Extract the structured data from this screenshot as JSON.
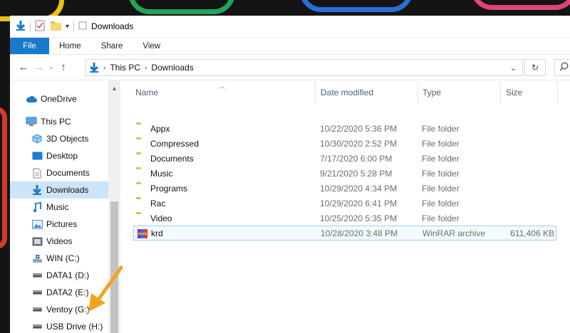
{
  "window": {
    "title": "Downloads",
    "colors": {
      "accent": "#1979ca",
      "selection": "#cce4f7",
      "folder": "#f8d775"
    }
  },
  "ribbon": {
    "tabs": [
      {
        "label": "File"
      },
      {
        "label": "Home"
      },
      {
        "label": "Share"
      },
      {
        "label": "View"
      }
    ]
  },
  "address": {
    "crumbs": [
      "This PC",
      "Downloads"
    ]
  },
  "sidebar": {
    "items": [
      {
        "label": "OneDrive",
        "icon": "cloud-icon"
      },
      {
        "label": "This PC",
        "icon": "computer-icon"
      },
      {
        "label": "3D Objects",
        "icon": "cube-icon"
      },
      {
        "label": "Desktop",
        "icon": "desktop-icon"
      },
      {
        "label": "Documents",
        "icon": "document-icon"
      },
      {
        "label": "Downloads",
        "icon": "download-icon",
        "selected": true
      },
      {
        "label": "Music",
        "icon": "music-icon"
      },
      {
        "label": "Pictures",
        "icon": "picture-icon"
      },
      {
        "label": "Videos",
        "icon": "video-icon"
      },
      {
        "label": "WIN (C:)",
        "icon": "windows-drive-icon"
      },
      {
        "label": "DATA1 (D:)",
        "icon": "drive-icon"
      },
      {
        "label": "DATA2 (E:)",
        "icon": "drive-icon"
      },
      {
        "label": "Ventoy (G:)",
        "icon": "drive-icon"
      },
      {
        "label": "USB Drive (H:)",
        "icon": "drive-icon"
      }
    ]
  },
  "columns": {
    "name": "Name",
    "date": "Date modified",
    "type": "Type",
    "size": "Size"
  },
  "files": [
    {
      "name": "Appx",
      "date": "10/22/2020 5:36 PM",
      "type": "File folder",
      "size": "",
      "icon": "folder-icon"
    },
    {
      "name": "Compressed",
      "date": "10/30/2020 2:52 PM",
      "type": "File folder",
      "size": "",
      "icon": "folder-icon"
    },
    {
      "name": "Documents",
      "date": "7/17/2020 6:00 PM",
      "type": "File folder",
      "size": "",
      "icon": "folder-icon"
    },
    {
      "name": "Music",
      "date": "9/21/2020 5:28 PM",
      "type": "File folder",
      "size": "",
      "icon": "folder-icon"
    },
    {
      "name": "Programs",
      "date": "10/29/2020 4:34 PM",
      "type": "File folder",
      "size": "",
      "icon": "folder-icon"
    },
    {
      "name": "Rac",
      "date": "10/29/2020 6:41 PM",
      "type": "File folder",
      "size": "",
      "icon": "folder-icon"
    },
    {
      "name": "Video",
      "date": "10/25/2020 5:35 PM",
      "type": "File folder",
      "size": "",
      "icon": "folder-icon"
    },
    {
      "name": "krd",
      "date": "10/28/2020 3:48 PM",
      "type": "WinRAR archive",
      "size": "611,406 KB",
      "icon": "winrar-archive-icon",
      "selected": true
    }
  ]
}
